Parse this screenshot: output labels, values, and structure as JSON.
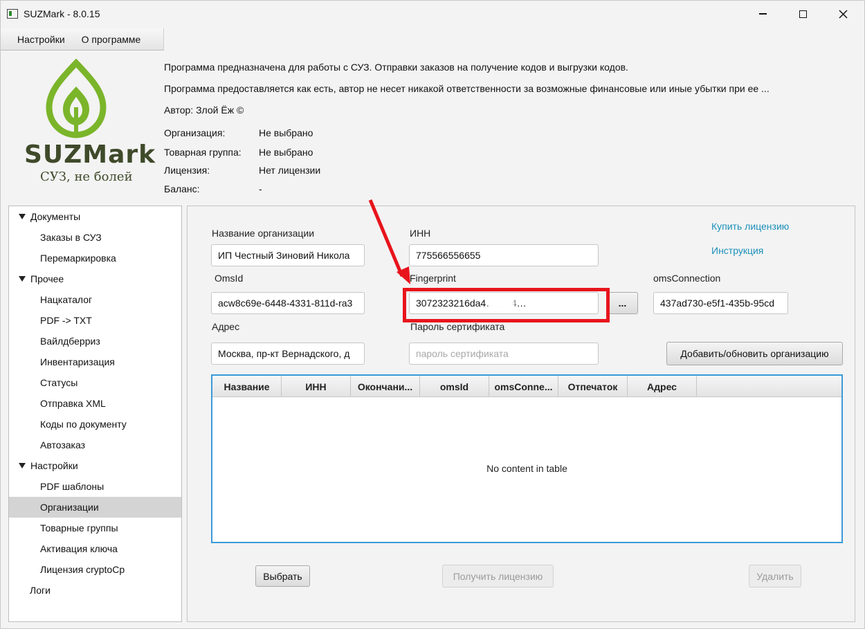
{
  "window": {
    "title": "SUZMark - 8.0.15"
  },
  "menu": {
    "items": [
      "Настройки",
      "О программе"
    ]
  },
  "logo": {
    "text": "SUZMark",
    "subtitle": "СУЗ, не болей"
  },
  "header": {
    "line1": "Программа предназначена для работы с СУЗ. Отправки заказов на получение кодов и выгрузки кодов.",
    "line2": "Программа предоставляется как есть, автор не несет никакой ответственности за возможные финансовые или иные убытки при ее ...",
    "author": "Автор: Злой Ёж ©",
    "details": [
      {
        "label": "Организация:",
        "value": "Не выбрано"
      },
      {
        "label": "Товарная группа:",
        "value": "Не выбрано"
      },
      {
        "label": "Лицензия:",
        "value": "Нет лицензии"
      },
      {
        "label": "Баланс:",
        "value": "-"
      }
    ]
  },
  "tree": {
    "items": [
      {
        "label": "Документы",
        "level": 0,
        "expanded": true
      },
      {
        "label": "Заказы в СУЗ",
        "level": 1
      },
      {
        "label": "Перемаркировка",
        "level": 1
      },
      {
        "label": "Прочее",
        "level": 0,
        "expanded": true
      },
      {
        "label": "Нацкаталог",
        "level": 1
      },
      {
        "label": "PDF -> TXT",
        "level": 1
      },
      {
        "label": "Вайлдберриз",
        "level": 1
      },
      {
        "label": "Инвентаризация",
        "level": 1
      },
      {
        "label": "Статусы",
        "level": 1
      },
      {
        "label": "Отправка XML",
        "level": 1
      },
      {
        "label": "Коды по документу",
        "level": 1
      },
      {
        "label": "Автозаказ",
        "level": 1
      },
      {
        "label": "Настройки",
        "level": 0,
        "expanded": true
      },
      {
        "label": "PDF шаблоны",
        "level": 1
      },
      {
        "label": "Организации",
        "level": 1,
        "selected": true
      },
      {
        "label": "Товарные группы",
        "level": 1
      },
      {
        "label": "Активация ключа",
        "level": 1
      },
      {
        "label": "Лицензия cryptoCp",
        "level": 1
      },
      {
        "label": "Логи",
        "level": 0
      }
    ]
  },
  "form": {
    "org_name_label": "Название организации",
    "org_name_value": "ИП Честный Зиновий Никола",
    "inn_label": "ИНН",
    "inn_value": "775566556655",
    "omsid_label": "OmsId",
    "omsid_value": "acw8c69e-6448-4331-811d-ra3",
    "fingerprint_label": "Fingerprint",
    "fingerprint_value": "3072323216da4…0c94…",
    "browse_label": "...",
    "oms_connection_label": "omsConnection",
    "oms_connection_value": "437ad730-e5f1-435b-95cd",
    "address_label": "Адрес",
    "address_value": "Москва, пр-кт Вернадского, д",
    "cert_password_label": "Пароль сертификата",
    "cert_password_placeholder": "пароль сертификата",
    "add_update_button": "Добавить/обновить организацию",
    "buy_license_link": "Купить лицензию",
    "instruction_link": "Инструкция"
  },
  "table": {
    "columns": [
      "Название",
      "ИНН",
      "Окончани...",
      "omsId",
      "omsConne...",
      "Отпечаток",
      "Адрес"
    ],
    "empty_message": "No content in table"
  },
  "actions": {
    "select": "Выбрать",
    "get_license": "Получить лицензию",
    "delete": "Удалить"
  },
  "colors": {
    "accent_link": "#1b8fb8",
    "table_focus": "#3a9ad9",
    "annotation_red": "#e8141c",
    "logo_green": "#7bb52a"
  }
}
